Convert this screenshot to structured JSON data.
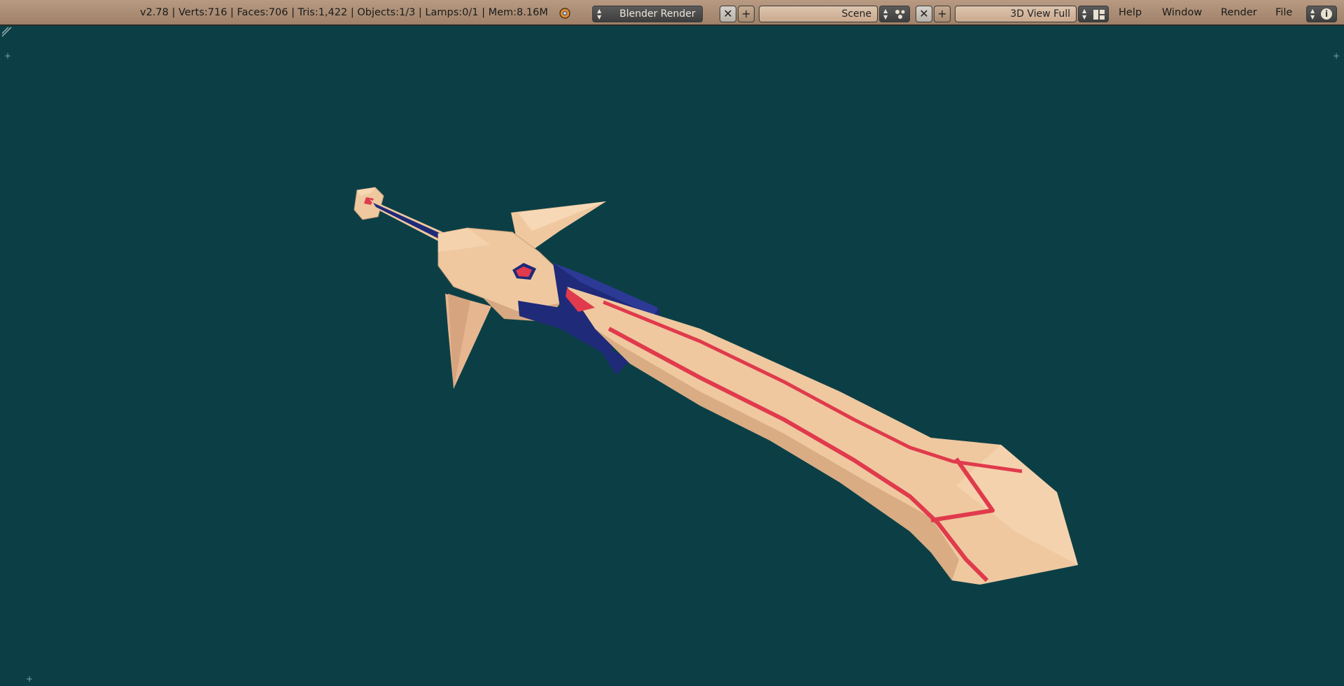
{
  "header": {
    "stats": "v2.78 | Verts:716 | Faces:706 | Tris:1,422 | Objects:1/3 | Lamps:0/1 | Mem:8.16M",
    "render_engine": "Blender Render",
    "scene": "Scene",
    "screen_layout": "3D View Full",
    "menus": {
      "help": "Help",
      "window": "Window",
      "render": "Render",
      "file": "File"
    },
    "info_icon": "i",
    "plus_glyph": "+",
    "close_glyph": "✕"
  },
  "colors": {
    "viewport_bg": "#0c3f45",
    "header_bg": "#a88b72",
    "blade": "#efc8a0",
    "blade_shade": "#d9ac84",
    "accent_red": "#e03a4c",
    "grip_blue": "#1f2a78"
  }
}
